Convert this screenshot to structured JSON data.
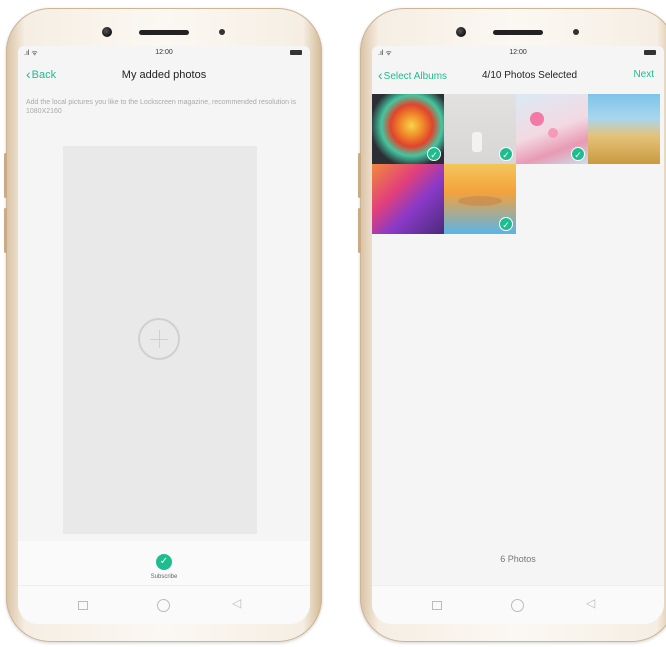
{
  "left_screen": {
    "status": {
      "time": "12:00",
      "signal": ".ıl ᯤ"
    },
    "nav": {
      "back_label": "Back",
      "title": "My added photos"
    },
    "hint": "Add the local pictures you like to the Lockscreen magazine, recommended resolution is 1080X2160",
    "subscribe_label": "Subscribe"
  },
  "right_screen": {
    "status": {
      "time": "12:00",
      "signal": ".ıl ᯤ"
    },
    "nav": {
      "back_label": "Select Albums",
      "title": "4/10 Photos Selected",
      "next_label": "Next"
    },
    "photos": [
      {
        "selected": true
      },
      {
        "selected": true
      },
      {
        "selected": true
      },
      {
        "selected": false
      },
      {
        "selected": false
      },
      {
        "selected": true
      }
    ],
    "photo_count": "6 Photos"
  },
  "icons": {
    "back": "chevron-left-icon",
    "check": "checkmark-icon",
    "plus": "plus-icon",
    "home": "circle-home-icon",
    "recents": "square-recents-icon",
    "back_nav": "triangle-back-icon"
  },
  "colors": {
    "accent": "#1dbd8f",
    "screen_bg": "#f5f5f5"
  }
}
